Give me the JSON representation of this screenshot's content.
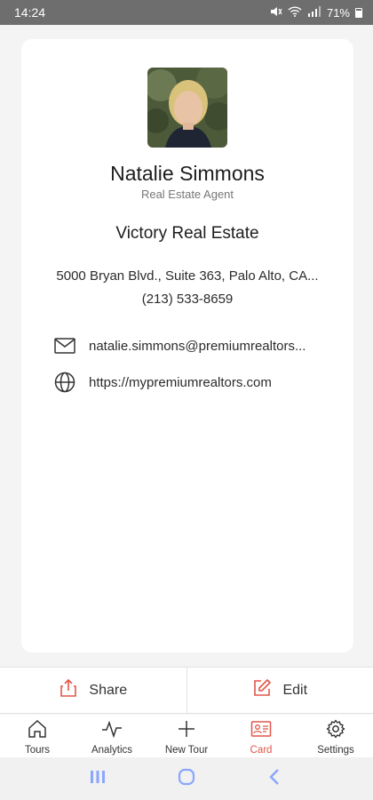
{
  "status_bar": {
    "time": "14:24",
    "battery": "71%",
    "icons": [
      "mute-icon",
      "wifi-icon",
      "signal-icon",
      "battery-icon"
    ]
  },
  "profile": {
    "name": "Natalie Simmons",
    "title": "Real Estate Agent",
    "company": "Victory Real Estate",
    "address": "5000 Bryan Blvd., Suite 363, Palo Alto, CA...",
    "phone": "(213) 533-8659",
    "email": "natalie.simmons@premiumrealtors...",
    "website": "https://mypremiumrealtors.com"
  },
  "actions": {
    "share_label": "Share",
    "edit_label": "Edit"
  },
  "tabs": [
    {
      "label": "Tours",
      "icon": "home-icon"
    },
    {
      "label": "Analytics",
      "icon": "pulse-icon"
    },
    {
      "label": "New Tour",
      "icon": "plus-icon"
    },
    {
      "label": "Card",
      "icon": "id-card-icon",
      "active": true
    },
    {
      "label": "Settings",
      "icon": "gear-icon"
    }
  ],
  "colors": {
    "accent": "#e0574a",
    "nav_icon": "#8aa6ff"
  }
}
